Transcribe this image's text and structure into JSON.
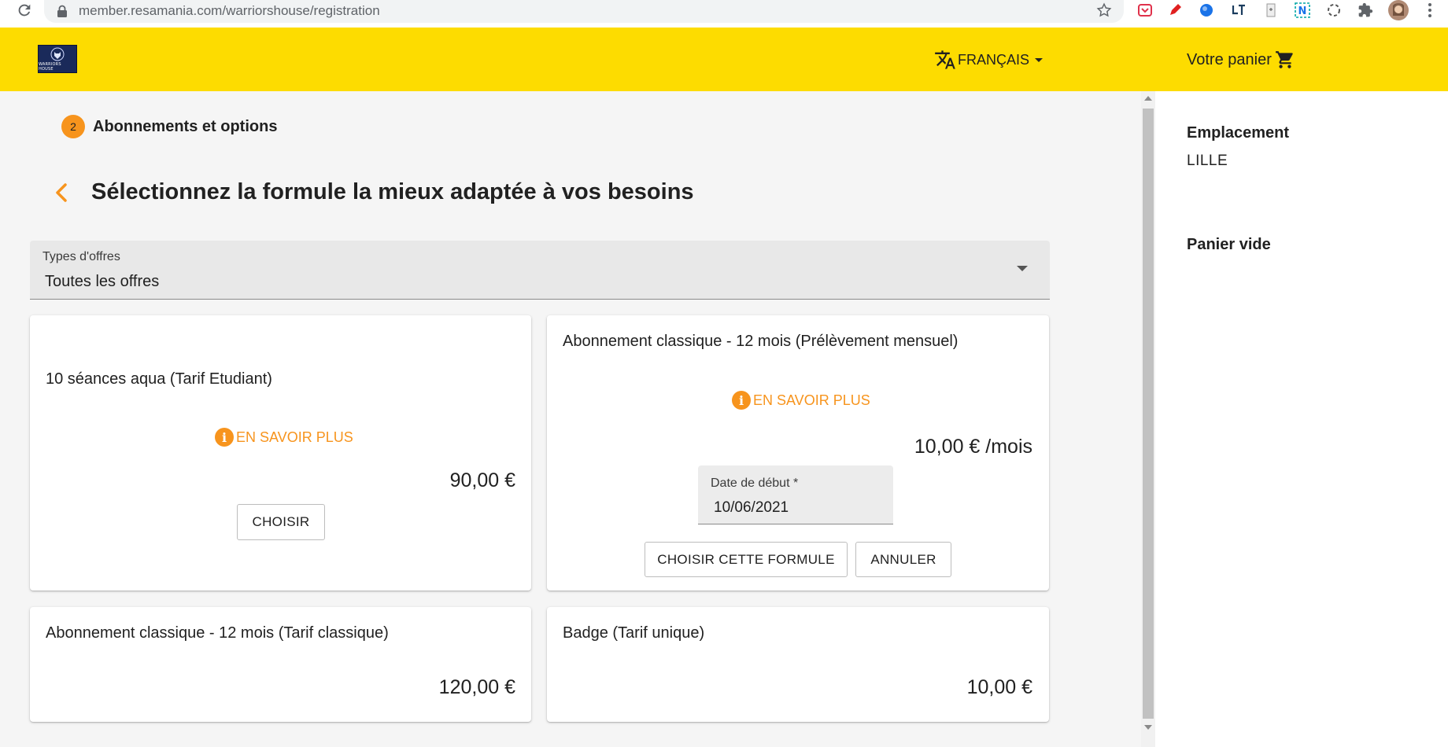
{
  "browser": {
    "url": "member.resamania.com/warriorshouse/registration"
  },
  "header": {
    "logo_text": "WARRIORS HOUSE",
    "language_label": "FRANÇAIS",
    "cart_label": "Votre panier"
  },
  "step": {
    "number": "2",
    "label": "Abonnements et options"
  },
  "page": {
    "title": "Sélectionnez la formule la mieux adaptée à vos besoins"
  },
  "filter": {
    "label": "Types d'offres",
    "value": "Toutes les offres"
  },
  "offers": [
    {
      "title": "10 séances aqua (Tarif Etudiant)",
      "info_label": "EN SAVOIR PLUS",
      "price": "90,00 €",
      "choose_label": "CHOISIR"
    },
    {
      "title": "Abonnement classique - 12 mois (Prélèvement mensuel)",
      "info_label": "EN SAVOIR PLUS",
      "price": "10,00 € /mois",
      "date_label": "Date de début *",
      "date_value": "10/06/2021",
      "confirm_label": "CHOISIR CETTE FORMULE",
      "cancel_label": "ANNULER"
    },
    {
      "title": "Abonnement classique - 12 mois (Tarif classique)",
      "price": "120,00 €"
    },
    {
      "title": "Badge (Tarif unique)",
      "price": "10,00 €"
    }
  ],
  "sidebar": {
    "location_title": "Emplacement",
    "location_value": "LILLE",
    "cart_status": "Panier vide"
  },
  "colors": {
    "header_bg": "#fddc00",
    "accent": "#f7941d"
  }
}
